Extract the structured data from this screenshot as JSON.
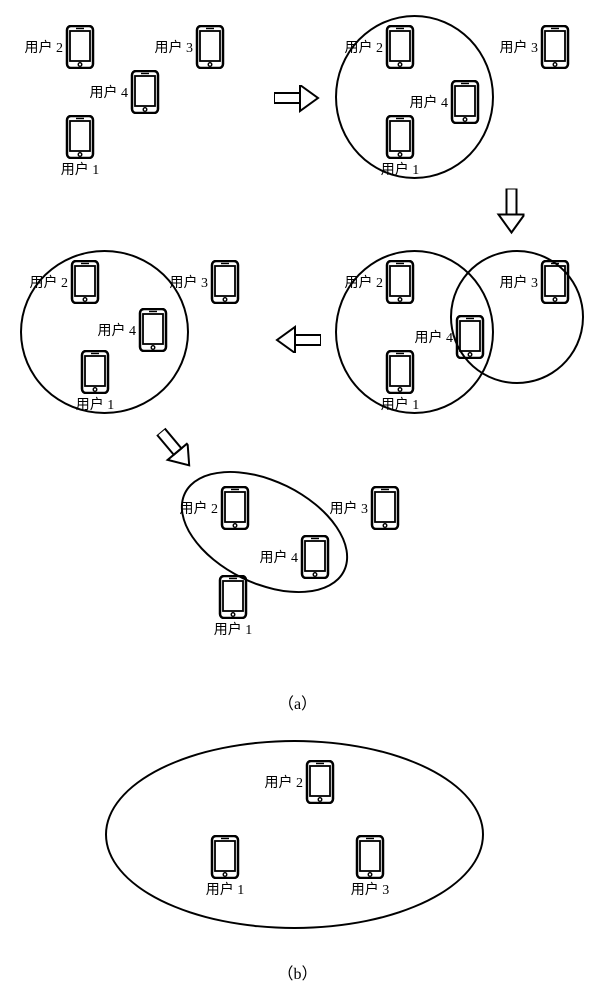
{
  "labels": {
    "user1": "用户 1",
    "user2": "用户 2",
    "user3": "用户 3",
    "user4": "用户 4"
  },
  "captions": {
    "a": "（a）",
    "b": "（b）"
  },
  "icons": {
    "phone": "smartphone-icon",
    "arrow": "arrow-icon"
  },
  "diagram": {
    "type": "clustering-sequence",
    "steps": [
      {
        "groups": []
      },
      {
        "groups": [
          [
            "user1",
            "user2",
            "user4"
          ]
        ]
      },
      {
        "groups": [
          [
            "user1",
            "user2",
            "user4"
          ],
          [
            "user3",
            "user4"
          ]
        ]
      },
      {
        "groups": [
          [
            "user1",
            "user2",
            "user4"
          ]
        ]
      },
      {
        "groups": [
          [
            "user2",
            "user4"
          ]
        ]
      }
    ],
    "subfigure_b_group": [
      "user1",
      "user2",
      "user3"
    ]
  }
}
